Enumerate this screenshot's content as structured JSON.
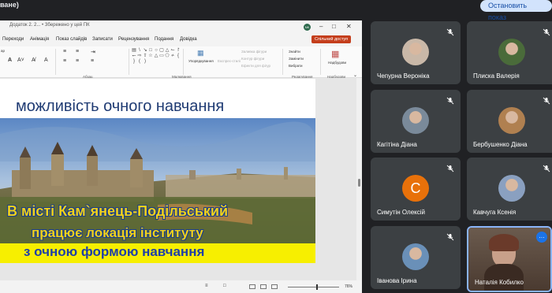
{
  "meeting": {
    "present_label": "ване)",
    "stop_presenting": "Остановить показ"
  },
  "app": {
    "title": "Додаток 2. 2... • Збережено у цей ПК",
    "avatar": "NK",
    "tabs": [
      "Переходи",
      "Анімація",
      "Показ слайдів",
      "Записати",
      "Рецензування",
      "Подання",
      "Довідка"
    ],
    "share_button": "Спільний доступ",
    "ribbon": {
      "group_shapes": "Малювання",
      "group_paragraph": "Абзац",
      "group_edit": "Редагування",
      "group_addins": "Надбудови",
      "arrange": "Упорядкування",
      "quick_styles": "Експрес-стилі",
      "shape_fill": "Заливка фігури",
      "shape_outline": "Контур фігури",
      "shape_effects": "Ефекти для фігур",
      "find": "Знайти",
      "replace": "Замінити",
      "select": "Вибрати",
      "addins": "Надбудови",
      "left_fragment": "ар"
    },
    "zoom": "76%"
  },
  "slide": {
    "title": "можливість очного навчання",
    "line1": "В  місті Кам`янець-Подільський",
    "line2": "працює  локація інституту",
    "line3": "з очною формою навчання"
  },
  "participants": [
    {
      "name": "Чепурна Вероніка",
      "kind": "photo",
      "tone": "#c9b8a8"
    },
    {
      "name": "Плиска Валерія",
      "kind": "photo",
      "tone": "#4a6b3a"
    },
    {
      "name": "Кагітіна Діана",
      "kind": "photo",
      "tone": "#7a8a9a"
    },
    {
      "name": "Бербушенко Діана",
      "kind": "photo",
      "tone": "#b08050"
    },
    {
      "name": "Симутін Олексій",
      "kind": "letter",
      "letter": "С",
      "tone": "#e8710a"
    },
    {
      "name": "Кавчуга Ксенія",
      "kind": "photo",
      "tone": "#8aa0c0"
    },
    {
      "name": "Іванова Ірина",
      "kind": "photo",
      "tone": "#6a90b8"
    },
    {
      "name": "Наталія Кобилко",
      "kind": "active"
    }
  ]
}
